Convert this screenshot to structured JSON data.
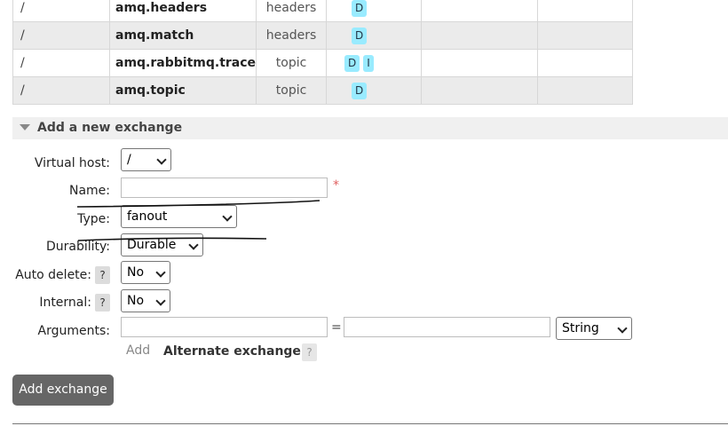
{
  "exchanges": [
    {
      "vhost": "/",
      "name": "amq.headers",
      "type": "headers",
      "features": [
        "D"
      ]
    },
    {
      "vhost": "/",
      "name": "amq.match",
      "type": "headers",
      "features": [
        "D"
      ]
    },
    {
      "vhost": "/",
      "name": "amq.rabbitmq.trace",
      "type": "topic",
      "features": [
        "D",
        "I"
      ]
    },
    {
      "vhost": "/",
      "name": "amq.topic",
      "type": "topic",
      "features": [
        "D"
      ]
    }
  ],
  "add_section": {
    "title": "Add a new exchange",
    "labels": {
      "vhost": "Virtual host:",
      "name": "Name:",
      "type": "Type:",
      "durability": "Durability:",
      "auto_delete": "Auto delete:",
      "internal": "Internal:",
      "arguments": "Arguments:"
    },
    "help": "?",
    "required_marker": "*",
    "vhost_value": "/",
    "name_value": "",
    "type_value": "fanout",
    "durability_value": "Durable",
    "auto_delete_value": "No",
    "internal_value": "No",
    "arg_key_value": "",
    "arg_equals": "=",
    "arg_value_value": "",
    "arg_type_value": "String",
    "add_link": "Add",
    "alternate_exchange": "Alternate exchange",
    "submit": "Add exchange"
  }
}
